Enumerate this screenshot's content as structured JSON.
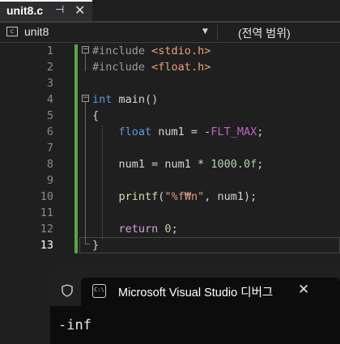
{
  "tab": {
    "filename": "unit8.c",
    "pin_glyph": "⊣",
    "close_glyph": "✕"
  },
  "navbar": {
    "scope": "unit8",
    "member": "(전역 범위)"
  },
  "editor": {
    "current_line": 13,
    "lines": [
      {
        "num": "1"
      },
      {
        "num": "2"
      },
      {
        "num": "3"
      },
      {
        "num": "4"
      },
      {
        "num": "5"
      },
      {
        "num": "6"
      },
      {
        "num": "7"
      },
      {
        "num": "8"
      },
      {
        "num": "9"
      },
      {
        "num": "10"
      },
      {
        "num": "11"
      },
      {
        "num": "12"
      },
      {
        "num": "13"
      }
    ],
    "tokens": {
      "l1_directive": "#include",
      "l1_header": "<stdio.h>",
      "l2_directive": "#include",
      "l2_header": "<float.h>",
      "l4_type": "int",
      "l4_rest": " main()",
      "l5_text": "{",
      "l6_type": "float",
      "l6_var": " num1 = -",
      "l6_macro": "FLT_MAX",
      "l6_end": ";",
      "l8_text": "num1 = num1 * ",
      "l8_num": "1000.0f",
      "l8_end": ";",
      "l10_fn": "printf",
      "l10_open": "(",
      "l10_str": "\"%f₩n\"",
      "l10_rest": ", num1);",
      "l12_kw": "return",
      "l12_num": " 0",
      "l12_end": ";",
      "l13_text": "}"
    }
  },
  "console": {
    "title": "Microsoft Visual Studio 디버그",
    "cmd_icon_text": "C:\\",
    "close_glyph": "✕",
    "output": "-inf"
  }
}
